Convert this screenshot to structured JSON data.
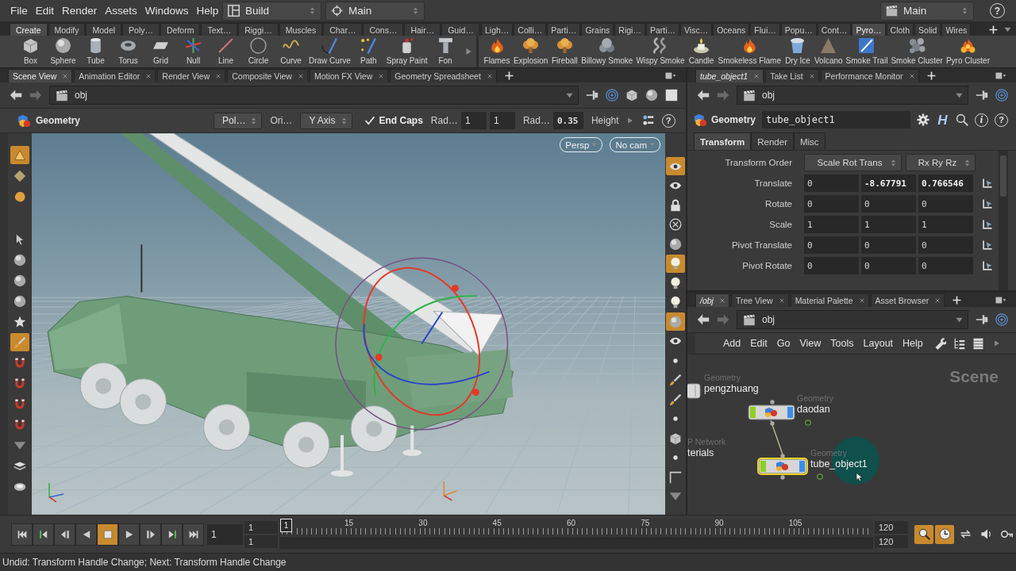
{
  "menu_bar": {
    "items": [
      "File",
      "Edit",
      "Render",
      "Assets",
      "Windows",
      "Help"
    ],
    "desktop": "Build",
    "viewport_layout": "Main",
    "scene_layout": "Main",
    "help": "?"
  },
  "shelves": [
    {
      "tabs": [
        {
          "label": "Create",
          "selected": true
        },
        {
          "label": "Modify",
          "selected": false
        },
        {
          "label": "Model",
          "selected": false
        },
        {
          "label": "Poly…",
          "selected": false
        },
        {
          "label": "Deform",
          "selected": false
        },
        {
          "label": "Text…",
          "selected": false
        },
        {
          "label": "Riggi…",
          "selected": false
        },
        {
          "label": "Muscles",
          "selected": false
        },
        {
          "label": "Char…",
          "selected": false
        },
        {
          "label": "Cons…",
          "selected": false
        },
        {
          "label": "Hair…",
          "selected": false
        },
        {
          "label": "Guid…",
          "selected": false
        }
      ],
      "tools": [
        "Box",
        "Sphere",
        "Tube",
        "Torus",
        "Grid",
        "Null",
        "Line",
        "Circle",
        "Curve",
        "Draw Curve",
        "Path",
        "Spray Paint",
        "Fon"
      ]
    },
    {
      "tabs": [
        {
          "label": "Ligh…",
          "selected": false
        },
        {
          "label": "Colli…",
          "selected": false
        },
        {
          "label": "Parti…",
          "selected": false
        },
        {
          "label": "Grains",
          "selected": false
        },
        {
          "label": "Rigi…",
          "selected": false
        },
        {
          "label": "Parti…",
          "selected": false
        },
        {
          "label": "Visc…",
          "selected": false
        },
        {
          "label": "Oceans",
          "selected": false
        },
        {
          "label": "Flui…",
          "selected": false
        },
        {
          "label": "Popu…",
          "selected": false
        },
        {
          "label": "Cont…",
          "selected": false
        },
        {
          "label": "Pyro…",
          "selected": true
        },
        {
          "label": "Cloth",
          "selected": false
        },
        {
          "label": "Solid",
          "selected": false
        },
        {
          "label": "Wires",
          "selected": false
        }
      ],
      "tools": [
        "Flames",
        "Explosion",
        "Fireball",
        "Billowy Smoke",
        "Wispy Smoke",
        "Candle",
        "Smokeless Flame",
        "Dry Ice",
        "Volcano",
        "Smoke Trail",
        "Smoke Cluster",
        "Pyro Cluster"
      ]
    }
  ],
  "scene_viewer": {
    "tabs": [
      {
        "label": "Scene View",
        "selected": true
      },
      {
        "label": "Animation Editor",
        "selected": false
      },
      {
        "label": "Render View",
        "selected": false
      },
      {
        "label": "Composite View",
        "selected": false
      },
      {
        "label": "Motion FX View",
        "selected": false
      },
      {
        "label": "Geometry Spreadsheet",
        "selected": false
      }
    ],
    "path": "obj",
    "tool_options": {
      "context": "Geometry",
      "primitive_type": "Pol…",
      "orientation_label": "Ori…",
      "orientation": "Y Axis",
      "end_caps": {
        "label": "End Caps",
        "checked": true
      },
      "radius_label": "Rad…",
      "radius": [
        "1",
        "1"
      ],
      "radius_scale_label": "Rad…",
      "radius_scale": "0.35",
      "height_label": "Height",
      "help": "?"
    },
    "view_buttons": [
      "Persp",
      "No cam"
    ],
    "left_tools": [
      {
        "selected": true
      },
      {
        "selected": false
      },
      {
        "selected": false
      },
      {
        "selected": false
      },
      {
        "selected": false
      },
      {
        "selected": false
      },
      {
        "selected": false
      },
      {
        "selected": false
      },
      {
        "selected": true
      },
      {
        "selected": false
      },
      {
        "selected": false
      },
      {
        "selected": false
      },
      {
        "selected": false
      },
      {
        "selected": false
      },
      {
        "selected": false
      },
      {
        "selected": false
      }
    ],
    "right_tools": [
      {
        "selected": true
      },
      {
        "selected": false
      },
      {
        "selected": false
      },
      {
        "selected": false
      },
      {
        "selected": false
      },
      {
        "selected": true
      },
      {
        "selected": false
      },
      {
        "selected": false
      },
      {
        "selected": true
      },
      {
        "selected": false
      },
      {
        "selected": false
      },
      {
        "selected": false
      },
      {
        "selected": false
      },
      {
        "selected": false
      },
      {
        "selected": false
      },
      {
        "selected": false
      },
      {
        "selected": false
      },
      {
        "selected": false
      }
    ]
  },
  "parameters": {
    "tabs": [
      {
        "label": "tube_object1",
        "selected": true,
        "follows_selection": true
      },
      {
        "label": "Take List",
        "selected": false,
        "follows_selection": false
      },
      {
        "label": "Performance Monitor",
        "selected": false,
        "follows_selection": false
      }
    ],
    "path": "obj",
    "node_type": "Geometry",
    "node_name": "tube_object1",
    "hda_glyph": "H",
    "info_glyph": "i",
    "help": "?",
    "folders": [
      {
        "label": "Transform",
        "selected": true
      },
      {
        "label": "Render",
        "selected": false
      },
      {
        "label": "Misc",
        "selected": false
      }
    ],
    "rows": [
      {
        "kind": "menus",
        "label": "Transform Order",
        "values": [
          "Scale Rot Trans",
          "Rx Ry Rz"
        ]
      },
      {
        "kind": "vector",
        "label": "Translate",
        "values": [
          {
            "value": "0",
            "modified": false
          },
          {
            "value": "-8.67791",
            "modified": true
          },
          {
            "value": "0.766546",
            "modified": true
          }
        ]
      },
      {
        "kind": "vector",
        "label": "Rotate",
        "values": [
          {
            "value": "0",
            "modified": false
          },
          {
            "value": "0",
            "modified": false
          },
          {
            "value": "0",
            "modified": false
          }
        ]
      },
      {
        "kind": "vector",
        "label": "Scale",
        "values": [
          {
            "value": "1",
            "modified": false
          },
          {
            "value": "1",
            "modified": false
          },
          {
            "value": "1",
            "modified": false
          }
        ]
      },
      {
        "kind": "vector",
        "label": "Pivot Translate",
        "values": [
          {
            "value": "0",
            "modified": false
          },
          {
            "value": "0",
            "modified": false
          },
          {
            "value": "0",
            "modified": false
          }
        ]
      },
      {
        "kind": "vector",
        "label": "Pivot Rotate",
        "values": [
          {
            "value": "0",
            "modified": false
          },
          {
            "value": "0",
            "modified": false
          },
          {
            "value": "0",
            "modified": false
          }
        ]
      }
    ]
  },
  "network": {
    "tabs": [
      {
        "label": "/obj",
        "selected": true,
        "follows_selection": true
      },
      {
        "label": "Tree View",
        "selected": false,
        "follows_selection": false
      },
      {
        "label": "Material Palette",
        "selected": false,
        "follows_selection": false
      },
      {
        "label": "Asset Browser",
        "selected": false,
        "follows_selection": false
      }
    ],
    "path": "obj",
    "menu": [
      "Add",
      "Edit",
      "Go",
      "View",
      "Tools",
      "Layout",
      "Help"
    ],
    "context": "Scene",
    "nodes": [
      {
        "type": "Geometry",
        "name": "pengzhuang",
        "selected": false
      },
      {
        "type": "Geometry",
        "name": "daodan",
        "selected": false
      },
      {
        "type": "Geometry",
        "name": "tube_object1",
        "selected": true
      },
      {
        "type": "P Network",
        "name": "terials",
        "selected": false
      }
    ]
  },
  "playbar": {
    "buttons": [
      {
        "selected": false
      },
      {
        "selected": false
      },
      {
        "selected": false
      },
      {
        "selected": false
      },
      {
        "selected": true
      },
      {
        "selected": false
      },
      {
        "selected": false
      },
      {
        "selected": false
      },
      {
        "selected": false
      }
    ],
    "frame": "1",
    "start": [
      "1",
      "1"
    ],
    "current_frame": "1",
    "ticks": [
      "15",
      "30",
      "45",
      "60",
      "75",
      "90",
      "105"
    ],
    "end": [
      "120",
      "120"
    ],
    "options": [
      {
        "selected": true
      },
      {
        "selected": true
      },
      {
        "selected": false
      },
      {
        "selected": false
      },
      {
        "selected": false
      }
    ]
  },
  "status_bar": {
    "message": "Undid: Transform Handle Change; Next: Transform Handle Change"
  }
}
